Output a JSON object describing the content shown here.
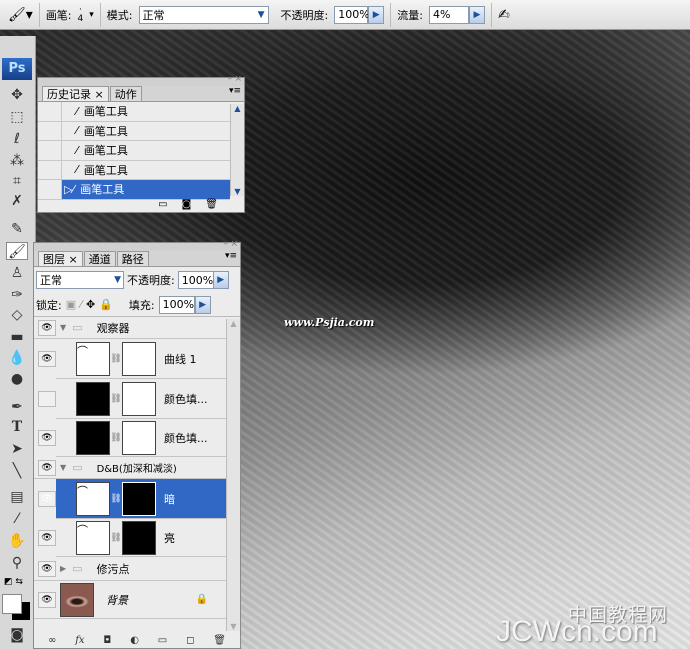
{
  "options_bar": {
    "brush_label": "画笔:",
    "brush_size": "4",
    "mode_label": "模式:",
    "mode_value": "正常",
    "opacity_label": "不透明度:",
    "opacity_value": "100%",
    "flow_label": "流量:",
    "flow_value": "4%"
  },
  "toolbox": {
    "logo": "Ps"
  },
  "history_panel": {
    "tabs": [
      "历史记录",
      "动作"
    ],
    "items": [
      "画笔工具",
      "画笔工具",
      "画笔工具",
      "画笔工具",
      "画笔工具"
    ],
    "selected_index": 4
  },
  "layers_panel": {
    "tabs": [
      "图层",
      "通道",
      "路径"
    ],
    "blend_mode": "正常",
    "opacity_label": "不透明度:",
    "opacity_value": "100%",
    "lock_label": "锁定:",
    "fill_label": "填充:",
    "fill_value": "100%",
    "layers": [
      {
        "name": "观察器",
        "type": "group",
        "visible": true,
        "expanded": true
      },
      {
        "name": "曲线 1",
        "type": "curves",
        "visible": true
      },
      {
        "name": "颜色填...",
        "type": "fill",
        "visible": false
      },
      {
        "name": "颜色填...",
        "type": "fill",
        "visible": true
      },
      {
        "name": "D&B(加深和减淡)",
        "type": "group",
        "visible": true,
        "expanded": true
      },
      {
        "name": "暗",
        "type": "curves",
        "visible": true,
        "selected": true
      },
      {
        "name": "亮",
        "type": "curves",
        "visible": true
      },
      {
        "name": "修污点",
        "type": "group",
        "visible": true,
        "expanded": false
      },
      {
        "name": "背景",
        "type": "background",
        "visible": true,
        "locked": true
      }
    ]
  },
  "watermarks": {
    "top": "www.Psjia.com",
    "bottom_cn": "中国教程网",
    "bottom_en": "JCWcn.com"
  },
  "colors": {
    "selection": "#3168c6",
    "accent_red": "#e01010"
  }
}
